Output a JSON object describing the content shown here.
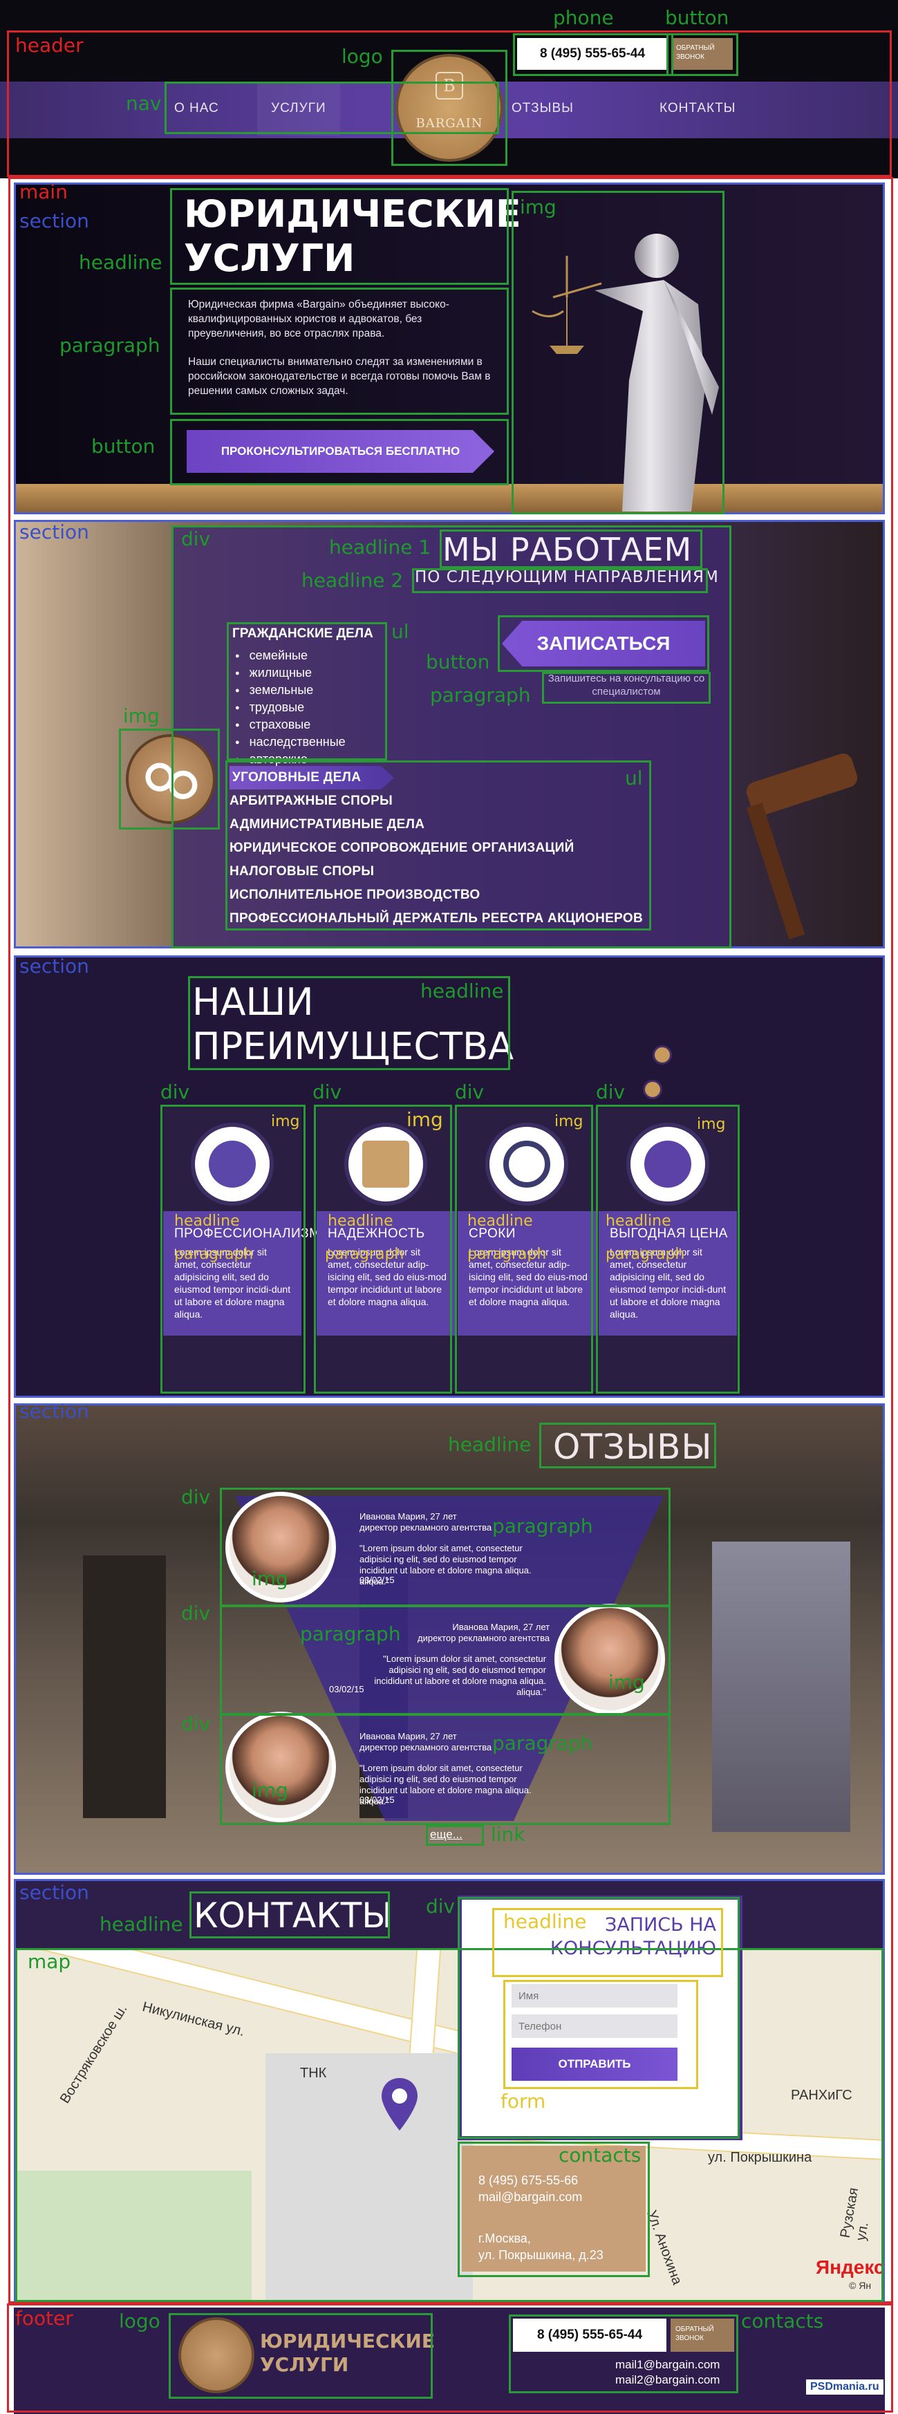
{
  "labels": {
    "header": "header",
    "main": "main",
    "section": "section",
    "nav": "nav",
    "logo": "logo",
    "phone": "phone",
    "button": "button",
    "headline": "headline",
    "headline1": "headline 1",
    "headline2": "headline 2",
    "paragraph": "paragraph",
    "img": "img",
    "div": "div",
    "ul": "ul",
    "link": "link",
    "map": "map",
    "form": "form",
    "contacts": "contacts",
    "footer": "footer"
  },
  "header": {
    "phone": "8 (495) 555-65-44",
    "callback": "ОБРАТНЫЙ ЗВОНОК",
    "nav": [
      "О НАС",
      "УСЛУГИ",
      "ОТЗЫВЫ",
      "КОНТАКТЫ"
    ],
    "logo_text": "BARGAIN",
    "logo_initial": "B"
  },
  "hero": {
    "title_line1": "ЮРИДИЧЕСКИЕ",
    "title_line2": "УСЛУГИ",
    "para1": "Юридическая фирма «Bargain» объединяет высоко-квалифицированных юристов и адвокатов, без преувеличения, во все отраслях права.",
    "para2": "Наши специалисты внимательно следят за изменениями в российском законодательстве и всегда готовы помочь Вам в решении самых сложных задач.",
    "button": "ПРОКОНСУЛЬТИРОВАТЬСЯ БЕСПЛАТНО"
  },
  "directions": {
    "h1": "МЫ РАБОТАЕМ",
    "h2": "ПО СЛЕДУЮЩИМ НАПРАВЛЕНИЯМ",
    "civil_title": "ГРАЖДАНСКИЕ ДЕЛА",
    "civil_items": [
      "семейные",
      "жилищные",
      "земельные",
      "трудовые",
      "страховые",
      "наследственные",
      "авторские"
    ],
    "register_button": "ЗАПИСАТЬСЯ",
    "register_note": "Запишитесь на консультацию со специалистом",
    "areas": [
      "УГОЛОВНЫЕ ДЕЛА",
      "АРБИТРАЖНЫЕ СПОРЫ",
      "АДМИНИСТРАТИВНЫЕ ДЕЛА",
      "ЮРИДИЧЕСКОЕ СОПРОВОЖДЕНИЕ ОРГАНИЗАЦИЙ",
      "НАЛОГОВЫЕ СПОРЫ",
      "ИСПОЛНИТЕЛЬНОЕ ПРОИЗВОДСТВО",
      "ПРОФЕССИОНАЛЬНЫЙ ДЕРЖАТЕЛЬ РЕЕСТРА АКЦИОНЕРОВ"
    ]
  },
  "advantages": {
    "title_line1": "НАШИ",
    "title_line2": "ПРЕИМУЩЕСТВА",
    "cards": [
      {
        "title": "ПРОФЕССИОНАЛИЗМ",
        "text": "Lorem ipsum dolor sit amet, consectetur adipisicing elit, sed do eiusmod tempor incidi-dunt ut labore et dolore magna aliqua.",
        "icon": "medal-icon",
        "color": "#5b47a8"
      },
      {
        "title": "НАДЕЖНОСТЬ",
        "text": "Lorem ipsum dolor sit amet, consectetur adip-isicing elit, sed do eius-mod tempor incididunt ut labore et dolore magna aliqua.",
        "icon": "document-icon",
        "color": "#c9a06a"
      },
      {
        "title": "СРОКИ",
        "text": "Lorem ipsum dolor sit amet, consectetur adip-isicing elit, sed do eius-mod tempor incididunt ut labore et dolore magna aliqua.",
        "icon": "stopwatch-icon",
        "color": "#3b3b6e"
      },
      {
        "title": "ВЫГОДНАЯ ЦЕНА",
        "text": "Lorem ipsum dolor sit amet, consectetur adipisicing elit, sed do eiusmod tempor incidi-dunt ut labore et dolore magna aliqua.",
        "icon": "piggy-bank-icon",
        "color": "#5c41a7"
      }
    ]
  },
  "reviews": {
    "title": "ОТЗЫВЫ",
    "items": [
      {
        "author": "Иванова Мария, 27 лет",
        "role": "директор рекламного агентства",
        "text": "\"Lorem ipsum dolor sit amet, consectetur adipisici ng elit, sed do eiusmod tempor incididunt ut labore et dolore magna aliqua. aliqua.\"",
        "date": "03/02/15"
      },
      {
        "author": "Иванова Мария, 27 лет",
        "role": "директор рекламного агентства",
        "text": "\"Lorem ipsum dolor sit amet, consectetur adipisici ng elit, sed do eiusmod tempor incididunt ut labore et dolore magna aliqua. aliqua.\"",
        "date": "03/02/15"
      },
      {
        "author": "Иванова Мария, 27 лет",
        "role": "директор рекламного агентства",
        "text": "\"Lorem ipsum dolor sit amet, consectetur adipisici ng elit, sed do eiusmod tempor incididunt ut labore et dolore magna aliqua. aliqua.\"",
        "date": "03/02/15"
      }
    ],
    "more": "еще..."
  },
  "contacts": {
    "title": "КОНТАКТЫ",
    "form_title": "ЗАПИСЬ НА КОНСУЛЬТАЦИЮ",
    "name_placeholder": "Имя",
    "phone_placeholder": "Телефон",
    "send": "ОТПРАВИТЬ",
    "phone": "8 (495) 675-55-66",
    "email": "mail@bargain.com",
    "city": "г.Москва,",
    "street": "ул. Покрышкина, д.23",
    "map_labels": [
      "Никулинская ул.",
      "Востряковское ш.",
      "ТНК",
      "РАНХиГС",
      "ул. Покрышкина",
      "Ул. Анохина",
      "Рузская ул."
    ],
    "yandex": "Яндекс",
    "map_copy": "© Ян"
  },
  "footer": {
    "title_line1": "ЮРИДИЧЕСКИЕ",
    "title_line2": "УСЛУГИ",
    "phone": "8 (495) 555-65-44",
    "callback": "ОБРАТНЫЙ ЗВОНОК",
    "mail1": "mail1@bargain.com",
    "mail2": "mail2@bargain.com",
    "badge": "PSDmania.ru"
  }
}
